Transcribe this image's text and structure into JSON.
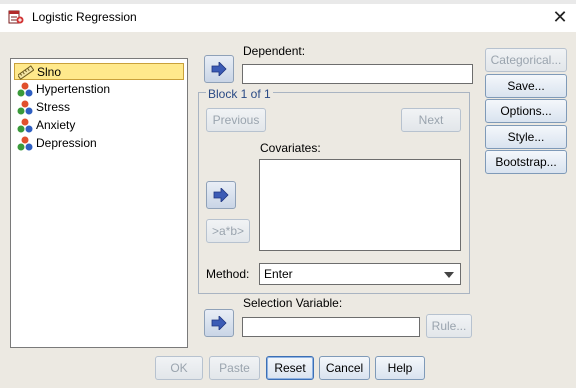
{
  "window": {
    "title": "Logistic Regression",
    "close_glyph": "✕"
  },
  "variables": [
    {
      "label": "Slno",
      "icon": "ruler-icon",
      "selected": true
    },
    {
      "label": "Hypertenstion",
      "icon": "nominal-variable-icon",
      "selected": false
    },
    {
      "label": "Stress",
      "icon": "nominal-variable-icon",
      "selected": false
    },
    {
      "label": "Anxiety",
      "icon": "nominal-variable-icon",
      "selected": false
    },
    {
      "label": "Depression",
      "icon": "nominal-variable-icon",
      "selected": false
    }
  ],
  "dependent": {
    "label": "Dependent:",
    "value": ""
  },
  "block": {
    "title": "Block 1 of 1",
    "previous_label": "Previous",
    "next_label": "Next",
    "covariates_label": "Covariates:",
    "interaction_label": ">a*b>"
  },
  "method": {
    "label": "Method:",
    "value": "Enter"
  },
  "selection": {
    "label": "Selection Variable:",
    "value": "",
    "rule_label": "Rule..."
  },
  "side_buttons": {
    "categorical": "Categorical...",
    "save": "Save...",
    "options": "Options...",
    "style": "Style...",
    "bootstrap": "Bootstrap..."
  },
  "bottom_buttons": {
    "ok": "OK",
    "paste": "Paste",
    "reset": "Reset",
    "cancel": "Cancel",
    "help": "Help"
  },
  "colors": {
    "dialog_bg": "#ece9e2",
    "selected_row": "#ffe98c",
    "arrow_fill": "#3b5bb5",
    "block_title": "#2a4a85"
  }
}
